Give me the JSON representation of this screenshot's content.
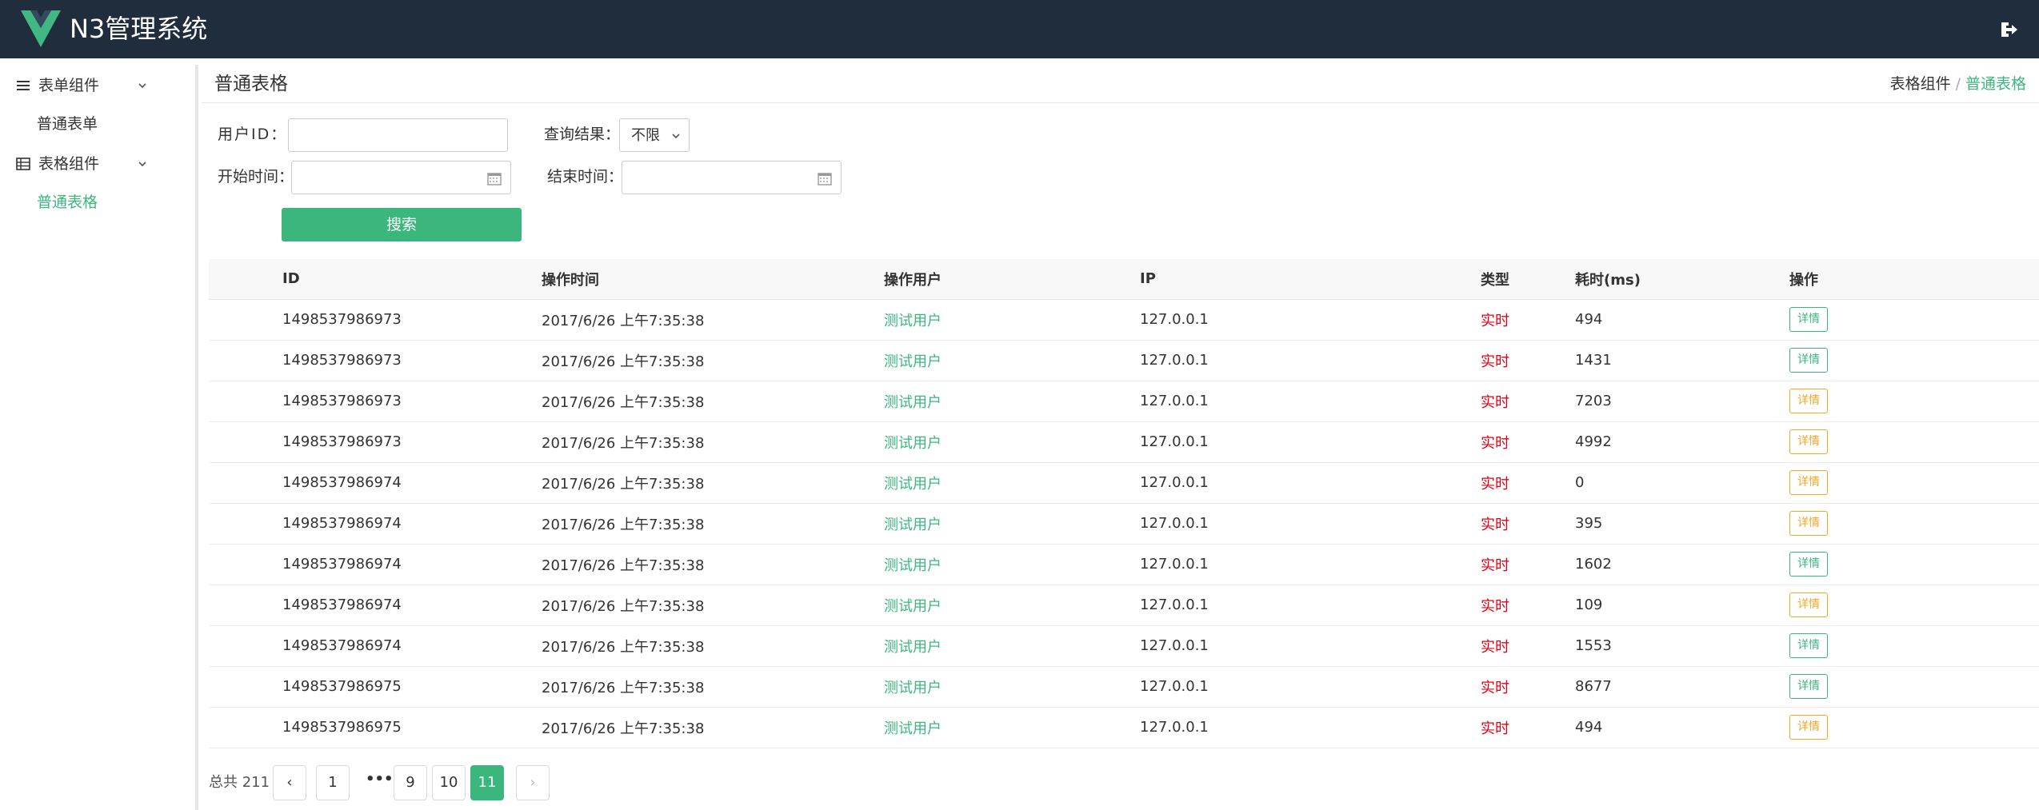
{
  "app": {
    "title": "N3管理系统",
    "brand_color": "#3bb77e",
    "header_color": "#1f2d3d"
  },
  "sidebar": {
    "groups": [
      {
        "label": "表单组件",
        "icon": "list-icon",
        "items": [
          {
            "label": "普通表单",
            "active": false
          }
        ]
      },
      {
        "label": "表格组件",
        "icon": "table-icon",
        "items": [
          {
            "label": "普通表格",
            "active": true
          }
        ]
      }
    ]
  },
  "page": {
    "title": "普通表格"
  },
  "breadcrumb": {
    "parent": "表格组件",
    "separator": "/",
    "current": "普通表格"
  },
  "filters": {
    "user_id_label": "用户ID：",
    "user_id_value": "",
    "result_label": "查询结果：",
    "result_value": "不限",
    "start_label": "开始时间：",
    "start_value": "",
    "end_label": "结束时间：",
    "end_value": "",
    "search_label": "搜索"
  },
  "table": {
    "headers": [
      "ID",
      "操作时间",
      "操作用户",
      "IP",
      "类型",
      "耗时(ms)",
      "操作"
    ],
    "rows": [
      {
        "id": "1498537986973",
        "time": "2017/6/26 上午7:35:38",
        "user": "测试用户",
        "ip": "127.0.0.1",
        "type": "实时",
        "cost": "494",
        "action": "详情",
        "action_color": "#3bb77e"
      },
      {
        "id": "1498537986973",
        "time": "2017/6/26 上午7:35:38",
        "user": "测试用户",
        "ip": "127.0.0.1",
        "type": "实时",
        "cost": "1431",
        "action": "详情",
        "action_color": "#3bb77e"
      },
      {
        "id": "1498537986973",
        "time": "2017/6/26 上午7:35:38",
        "user": "测试用户",
        "ip": "127.0.0.1",
        "type": "实时",
        "cost": "7203",
        "action": "详情",
        "action_color": "#f5a623"
      },
      {
        "id": "1498537986973",
        "time": "2017/6/26 上午7:35:38",
        "user": "测试用户",
        "ip": "127.0.0.1",
        "type": "实时",
        "cost": "4992",
        "action": "详情",
        "action_color": "#f5a623"
      },
      {
        "id": "1498537986974",
        "time": "2017/6/26 上午7:35:38",
        "user": "测试用户",
        "ip": "127.0.0.1",
        "type": "实时",
        "cost": "0",
        "action": "详情",
        "action_color": "#f5a623"
      },
      {
        "id": "1498537986974",
        "time": "2017/6/26 上午7:35:38",
        "user": "测试用户",
        "ip": "127.0.0.1",
        "type": "实时",
        "cost": "395",
        "action": "详情",
        "action_color": "#f5a623"
      },
      {
        "id": "1498537986974",
        "time": "2017/6/26 上午7:35:38",
        "user": "测试用户",
        "ip": "127.0.0.1",
        "type": "实时",
        "cost": "1602",
        "action": "详情",
        "action_color": "#3bb77e"
      },
      {
        "id": "1498537986974",
        "time": "2017/6/26 上午7:35:38",
        "user": "测试用户",
        "ip": "127.0.0.1",
        "type": "实时",
        "cost": "109",
        "action": "详情",
        "action_color": "#f5a623"
      },
      {
        "id": "1498537986974",
        "time": "2017/6/26 上午7:35:38",
        "user": "测试用户",
        "ip": "127.0.0.1",
        "type": "实时",
        "cost": "1553",
        "action": "详情",
        "action_color": "#3bb77e"
      },
      {
        "id": "1498537986975",
        "time": "2017/6/26 上午7:35:38",
        "user": "测试用户",
        "ip": "127.0.0.1",
        "type": "实时",
        "cost": "8677",
        "action": "详情",
        "action_color": "#3bb77e"
      },
      {
        "id": "1498537986975",
        "time": "2017/6/26 上午7:35:38",
        "user": "测试用户",
        "ip": "127.0.0.1",
        "type": "实时",
        "cost": "494",
        "action": "详情",
        "action_color": "#f5a623"
      }
    ]
  },
  "pagination": {
    "total_label": "总共 211",
    "prev": "‹",
    "next": "›",
    "ellipsis": "•••",
    "pages": [
      "1",
      "9",
      "10",
      "11"
    ],
    "current": "11"
  }
}
